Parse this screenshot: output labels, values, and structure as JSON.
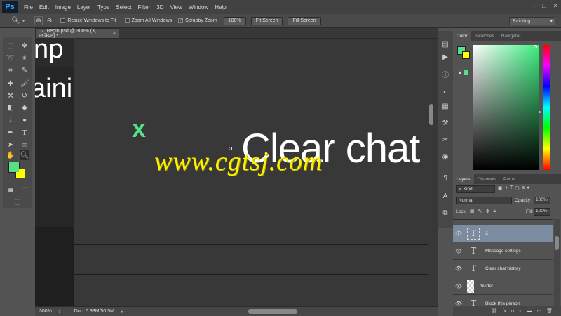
{
  "app": {
    "logo": "Ps"
  },
  "menu": [
    "File",
    "Edit",
    "Image",
    "Layer",
    "Type",
    "Select",
    "Filter",
    "3D",
    "View",
    "Window",
    "Help"
  ],
  "window_controls": [
    "–",
    "□",
    "✕"
  ],
  "options": {
    "resize_windows": "Resize Windows to Fit",
    "zoom_all": "Zoom All Windows",
    "scrubby": "Scrubby Zoom",
    "btn_100": "100%",
    "fit_screen": "Fit Screen",
    "fill_screen": "Fill Screen",
    "workspace": "Painting"
  },
  "document": {
    "tab_title": "07_Begin.psd @ 300% (X, RGB/8) *",
    "close": "×",
    "canvas_x": "x",
    "canvas_text": "Clear chat",
    "left_text_1": "np",
    "left_text_2": "aini",
    "watermark": "www.cgtsj.com"
  },
  "status": {
    "zoom": "300%",
    "doc": "Doc: 5.93M/50.5M"
  },
  "color_panel": {
    "tabs": [
      "Color",
      "Swatches",
      "Navigator"
    ],
    "fg_color": "#56e089",
    "bg_color": "#ffff00"
  },
  "layers_panel": {
    "tabs": [
      "Layers",
      "Channels",
      "Paths"
    ],
    "filter_kind": "Kind",
    "blend_mode": "Normal",
    "opacity_label": "Opacity:",
    "opacity": "100%",
    "lock_label": "Lock:",
    "fill_label": "Fill:",
    "fill": "100%",
    "layers": [
      {
        "name": "X",
        "type": "text",
        "selected": true
      },
      {
        "name": "Message settings",
        "type": "text",
        "selected": false
      },
      {
        "name": "Clear chat history",
        "type": "text",
        "selected": false
      },
      {
        "name": "divider",
        "type": "image",
        "selected": false
      },
      {
        "name": "Block this person",
        "type": "text",
        "selected": false
      }
    ],
    "footer_icons": [
      "link-icon",
      "fx-icon",
      "mask-icon",
      "adjustment-icon",
      "folder-icon",
      "new-layer-icon",
      "trash-icon"
    ]
  }
}
